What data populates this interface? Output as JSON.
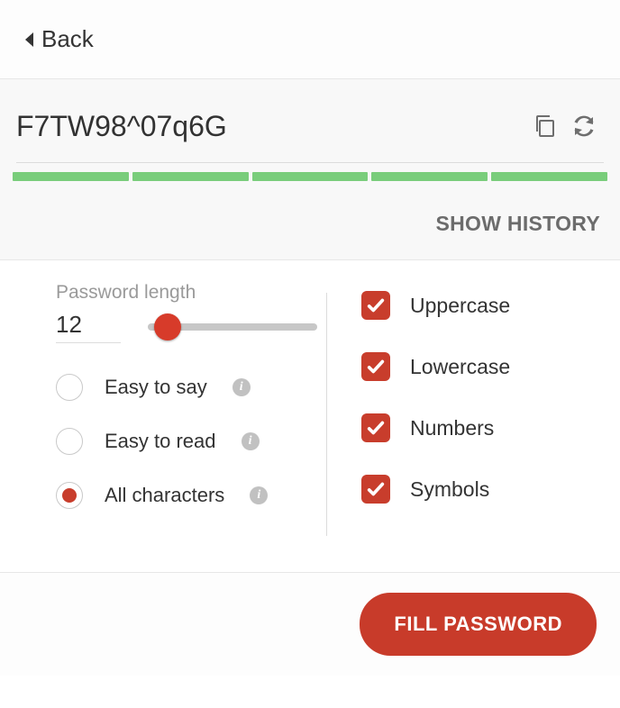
{
  "header": {
    "back_label": "Back"
  },
  "password": {
    "value": "F7TW98^07q6G",
    "strength_segments": 5,
    "show_history_label": "SHOW HISTORY"
  },
  "length": {
    "label": "Password length",
    "value": "12",
    "min": 1,
    "max": 50
  },
  "radio_options": [
    {
      "key": "easy-say",
      "label": "Easy to say",
      "selected": false,
      "info": true
    },
    {
      "key": "easy-read",
      "label": "Easy to read",
      "selected": false,
      "info": true
    },
    {
      "key": "all-chars",
      "label": "All characters",
      "selected": true,
      "info": true
    }
  ],
  "checkbox_options": [
    {
      "key": "uppercase",
      "label": "Uppercase",
      "checked": true
    },
    {
      "key": "lowercase",
      "label": "Lowercase",
      "checked": true
    },
    {
      "key": "numbers",
      "label": "Numbers",
      "checked": true
    },
    {
      "key": "symbols",
      "label": "Symbols",
      "checked": true
    }
  ],
  "footer": {
    "fill_label": "FILL PASSWORD"
  },
  "colors": {
    "accent": "#c83d2c",
    "strength": "#79cd7b"
  }
}
